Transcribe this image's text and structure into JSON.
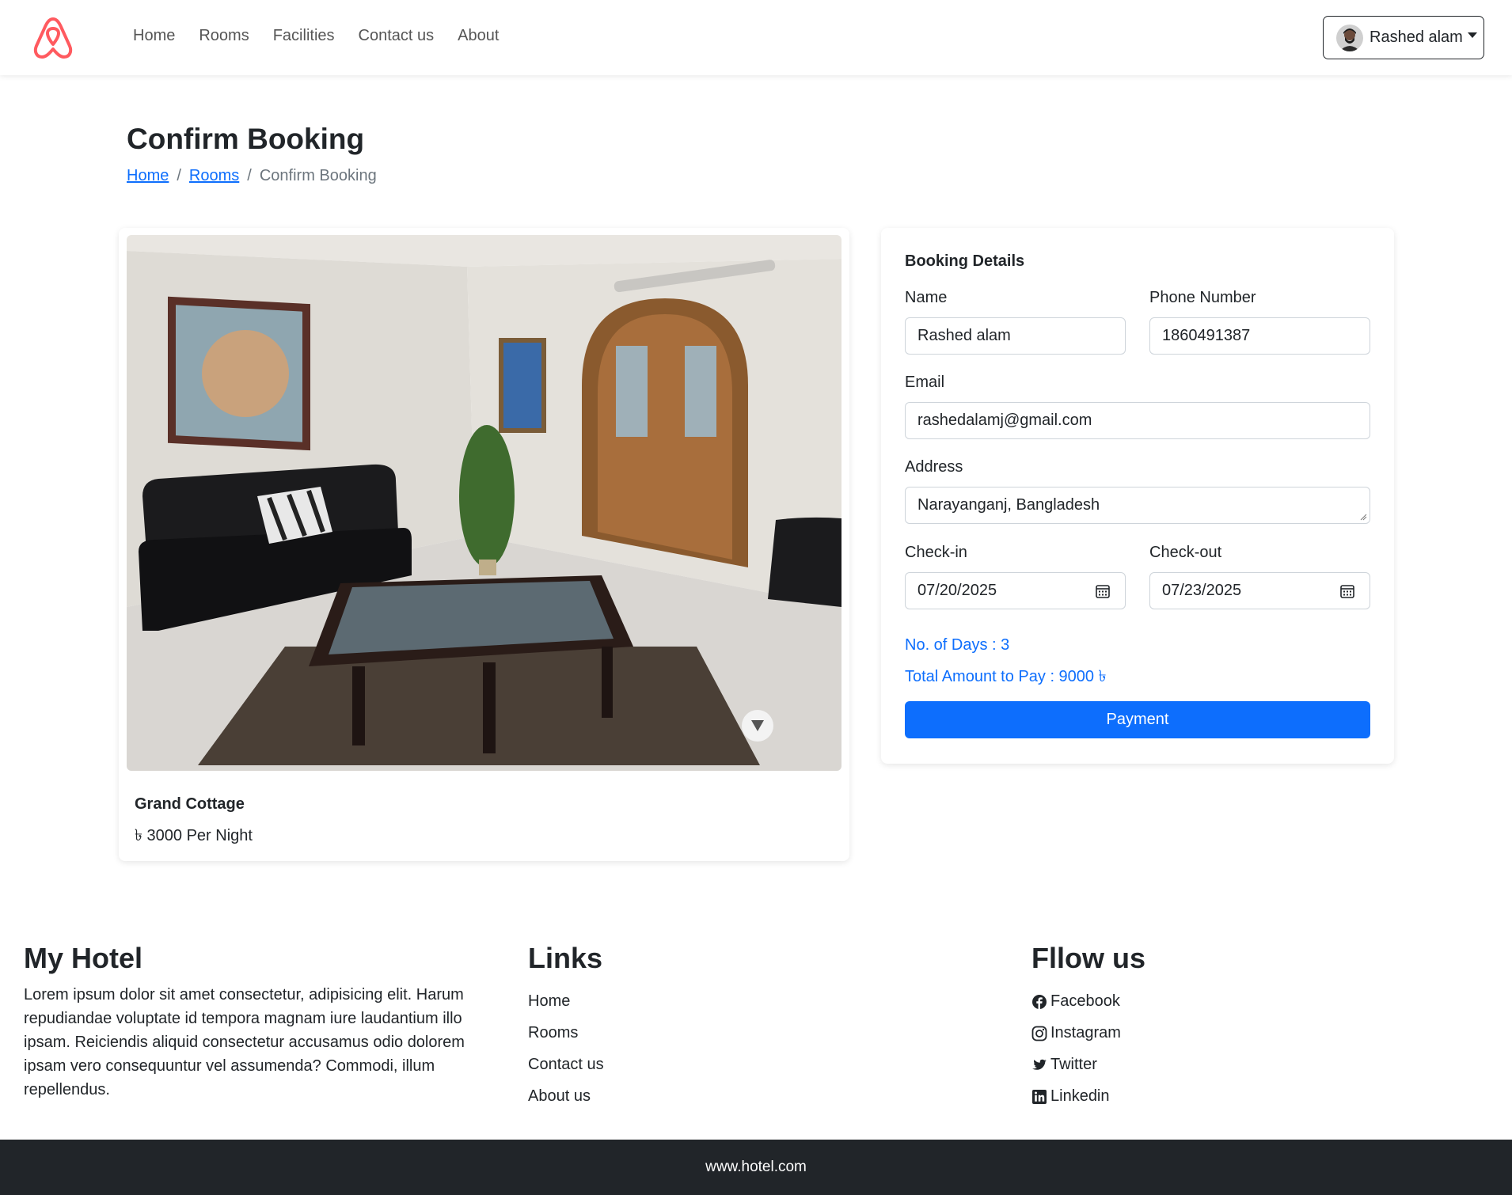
{
  "navbar": {
    "logo_icon": "airbnb-logo-icon",
    "links": [
      "Home",
      "Rooms",
      "Facilities",
      "Contact us",
      "About"
    ],
    "user_name": "Rashed alam"
  },
  "header": {
    "title": "Confirm Booking",
    "breadcrumb": [
      "Home",
      "Rooms",
      "Confirm Booking"
    ],
    "separator": "/"
  },
  "room": {
    "name": "Grand Cottage",
    "price": "৳ 3000 Per Night"
  },
  "booking": {
    "title": "Booking Details",
    "name_label": "Name",
    "name_value": "Rashed alam",
    "phone_label": "Phone Number",
    "phone_value": "1860491387",
    "email_label": "Email",
    "email_value": "rashedalamj@gmail.com",
    "address_label": "Address",
    "address_value": "Narayanganj, Bangladesh",
    "checkin_label": "Check-in",
    "checkin_value": "07/20/2025",
    "checkout_label": "Check-out",
    "checkout_value": "07/23/2025",
    "days_text": "No. of Days : 3",
    "total_text": "Total Amount to Pay : 9000 ৳",
    "payment_label": "Payment"
  },
  "footer": {
    "about_heading": "My Hotel",
    "about_text": "Lorem ipsum dolor sit amet consectetur, adipisicing elit. Harum repudiandae voluptate id tempora magnam iure laudantium illo ipsam. Reiciendis aliquid consectetur accusamus odio dolorem ipsam vero consequuntur vel assumenda? Commodi, illum repellendus.",
    "links_heading": "Links",
    "links": [
      "Home",
      "Rooms",
      "Contact us",
      "About us"
    ],
    "social_heading": "Fllow us",
    "social": [
      "Facebook",
      "Instagram",
      "Twitter",
      "Linkedin"
    ],
    "bottom_text": "www.hotel.com"
  },
  "colors": {
    "primary": "#0d6efd",
    "brand": "#FF5A5F",
    "dark": "#212529"
  }
}
